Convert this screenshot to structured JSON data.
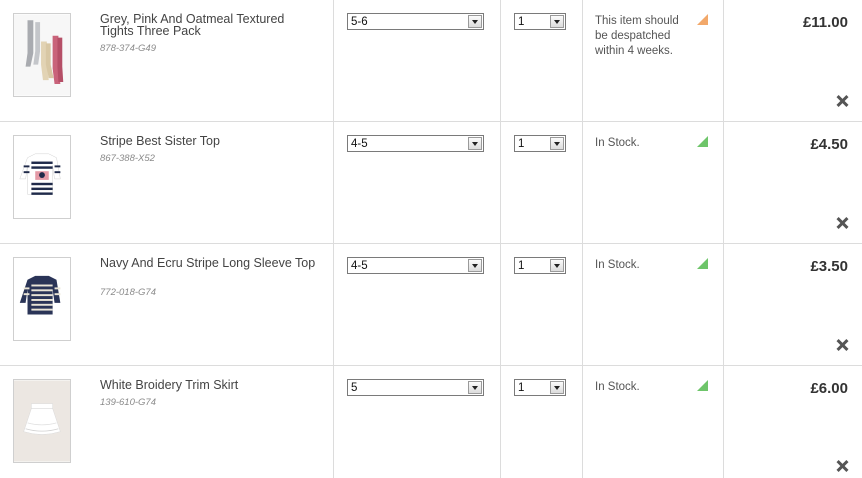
{
  "basket": {
    "items": [
      {
        "title": "Grey, Pink And Oatmeal Textured Tights Three Pack",
        "code": "878-374-G49",
        "size": "5-6",
        "quantity": "1",
        "stock_text": "This item should be despatched within 4 weeks.",
        "stock_color": "#f2a86a",
        "price": "£11.00",
        "image_icon": "tights-product-image"
      },
      {
        "title": "Stripe Best Sister Top",
        "code": "867-388-X52",
        "size": "4-5",
        "quantity": "1",
        "stock_text": "In Stock.",
        "stock_color": "#6ec56a",
        "price": "£4.50",
        "image_icon": "striped-top-product-image"
      },
      {
        "title": "Navy And Ecru Stripe Long Sleeve Top",
        "code": "772-018-G74",
        "size": "4-5",
        "quantity": "1",
        "stock_text": "In Stock.",
        "stock_color": "#6ec56a",
        "price": "£3.50",
        "image_icon": "navy-stripe-top-product-image"
      },
      {
        "title": "White Broidery Trim Skirt",
        "code": "139-610-G74",
        "size": "5",
        "quantity": "1",
        "stock_text": "In Stock.",
        "stock_color": "#6ec56a",
        "price": "£6.00",
        "image_icon": "skirt-product-image"
      }
    ]
  }
}
